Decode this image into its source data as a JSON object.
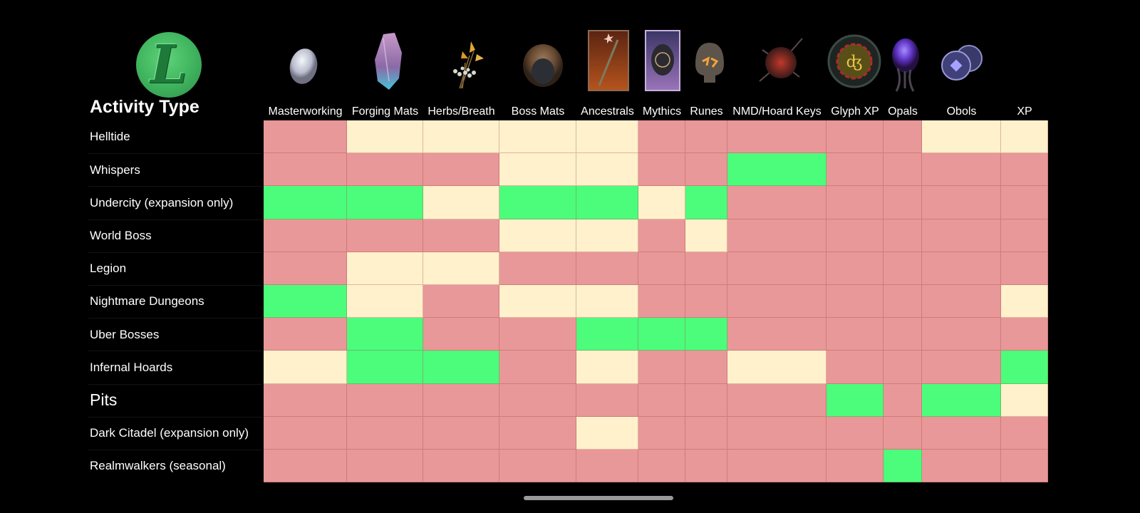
{
  "title": "Activity Type",
  "logo": {
    "letter": "L",
    "icon": "green-l-emblem-icon"
  },
  "legend_colors": {
    "best": "#4cfd7c",
    "some": "#fff1cc",
    "none": "#e89898"
  },
  "chart_data": {
    "type": "heatmap",
    "title": "Activity Type",
    "xlabel": "",
    "ylabel": "",
    "columns": [
      {
        "label": "Masterworking",
        "icon": "masterworking-stone-icon"
      },
      {
        "label": "Forging Mats",
        "icon": "forging-crystal-icon"
      },
      {
        "label": "Herbs/Breath",
        "icon": "herb-bouquet-icon"
      },
      {
        "label": "Boss Mats",
        "icon": "boss-material-shell-icon"
      },
      {
        "label": "Ancestrals",
        "icon": "ancestral-sword-card-icon"
      },
      {
        "label": "Mythics",
        "icon": "mythic-card-icon"
      },
      {
        "label": "Runes",
        "icon": "rune-stone-icon"
      },
      {
        "label": "NMD/Hoard Keys",
        "icon": "thorned-key-icon"
      },
      {
        "label": "Glyph XP",
        "icon": "glyph-seal-icon"
      },
      {
        "label": "Opals",
        "icon": "opal-gem-icon"
      },
      {
        "label": "Obols",
        "icon": "obol-coins-icon"
      },
      {
        "label": "XP",
        "icon": ""
      }
    ],
    "rows": [
      {
        "label": "Helltide",
        "big": false,
        "values": [
          "none",
          "some",
          "some",
          "some",
          "some",
          "none",
          "none",
          "none",
          "none",
          "none",
          "some",
          "some"
        ]
      },
      {
        "label": "Whispers",
        "big": false,
        "values": [
          "none",
          "none",
          "none",
          "some",
          "some",
          "none",
          "none",
          "best",
          "none",
          "none",
          "none",
          "none"
        ]
      },
      {
        "label": "Undercity (expansion only)",
        "big": false,
        "values": [
          "best",
          "best",
          "some",
          "best",
          "best",
          "some",
          "best",
          "none",
          "none",
          "none",
          "none",
          "none"
        ]
      },
      {
        "label": "World Boss",
        "big": false,
        "values": [
          "none",
          "none",
          "none",
          "some",
          "some",
          "none",
          "some",
          "none",
          "none",
          "none",
          "none",
          "none"
        ]
      },
      {
        "label": "Legion",
        "big": false,
        "values": [
          "none",
          "some",
          "some",
          "none",
          "none",
          "none",
          "none",
          "none",
          "none",
          "none",
          "none",
          "none"
        ]
      },
      {
        "label": "Nightmare Dungeons",
        "big": false,
        "values": [
          "best",
          "some",
          "none",
          "some",
          "some",
          "none",
          "none",
          "none",
          "none",
          "none",
          "none",
          "some"
        ]
      },
      {
        "label": "Uber Bosses",
        "big": false,
        "values": [
          "none",
          "best",
          "none",
          "none",
          "best",
          "best",
          "best",
          "none",
          "none",
          "none",
          "none",
          "none"
        ]
      },
      {
        "label": "Infernal Hoards",
        "big": false,
        "values": [
          "some",
          "best",
          "best",
          "none",
          "some",
          "none",
          "none",
          "some",
          "none",
          "none",
          "none",
          "best"
        ]
      },
      {
        "label": "Pits",
        "big": true,
        "values": [
          "none",
          "none",
          "none",
          "none",
          "none",
          "none",
          "none",
          "none",
          "best",
          "none",
          "best",
          "some"
        ]
      },
      {
        "label": "Dark Citadel (expansion only)",
        "big": false,
        "values": [
          "none",
          "none",
          "none",
          "none",
          "some",
          "none",
          "none",
          "none",
          "none",
          "none",
          "none",
          "none"
        ]
      },
      {
        "label": "Realmwalkers (seasonal)",
        "big": false,
        "values": [
          "none",
          "none",
          "none",
          "none",
          "none",
          "none",
          "none",
          "none",
          "none",
          "best",
          "none",
          "none"
        ]
      }
    ]
  }
}
